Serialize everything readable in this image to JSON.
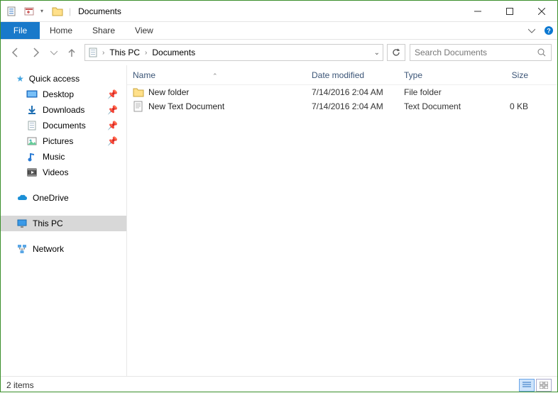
{
  "titlebar": {
    "title": "Documents"
  },
  "ribbon": {
    "file": "File",
    "tabs": [
      "Home",
      "Share",
      "View"
    ]
  },
  "breadcrumb": {
    "items": [
      "This PC",
      "Documents"
    ]
  },
  "search": {
    "placeholder": "Search Documents"
  },
  "sidebar": {
    "quick_access": {
      "label": "Quick access",
      "items": [
        {
          "label": "Desktop",
          "pinned": true,
          "icon": "desktop-icon"
        },
        {
          "label": "Downloads",
          "pinned": true,
          "icon": "downloads-icon"
        },
        {
          "label": "Documents",
          "pinned": true,
          "icon": "documents-icon"
        },
        {
          "label": "Pictures",
          "pinned": true,
          "icon": "pictures-icon"
        },
        {
          "label": "Music",
          "pinned": false,
          "icon": "music-icon"
        },
        {
          "label": "Videos",
          "pinned": false,
          "icon": "videos-icon"
        }
      ]
    },
    "onedrive": "OneDrive",
    "thispc": "This PC",
    "network": "Network"
  },
  "columns": {
    "name": "Name",
    "date": "Date modified",
    "type": "Type",
    "size": "Size"
  },
  "files": [
    {
      "name": "New folder",
      "date": "7/14/2016 2:04 AM",
      "type": "File folder",
      "size": "",
      "icon": "folder-icon"
    },
    {
      "name": "New Text Document",
      "date": "7/14/2016 2:04 AM",
      "type": "Text Document",
      "size": "0 KB",
      "icon": "text-file-icon"
    }
  ],
  "status": {
    "count": "2 items"
  }
}
